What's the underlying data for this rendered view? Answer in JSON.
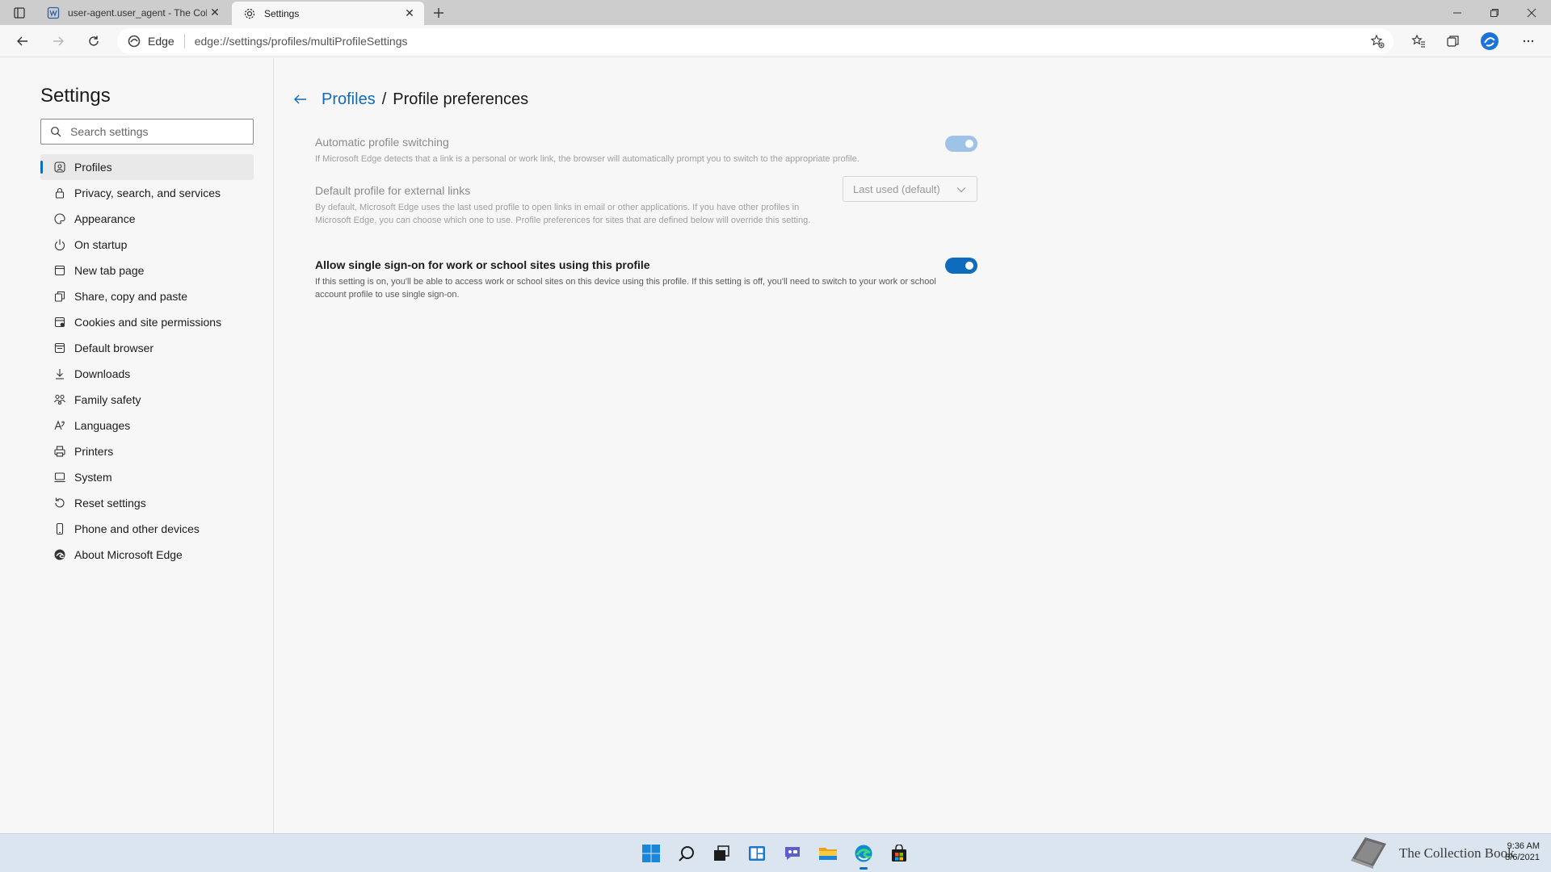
{
  "browser": {
    "tabs": [
      {
        "title": "user-agent.user_agent - The Coll",
        "favicon": "document-icon",
        "active": false
      },
      {
        "title": "Settings",
        "favicon": "gear-icon",
        "active": true
      }
    ],
    "address": {
      "site_label": "Edge",
      "url": "edge://settings/profiles/multiProfileSettings"
    }
  },
  "sidebar": {
    "title": "Settings",
    "search_placeholder": "Search settings",
    "items": [
      {
        "label": "Profiles",
        "icon": "profile-icon",
        "selected": true
      },
      {
        "label": "Privacy, search, and services",
        "icon": "lock-icon"
      },
      {
        "label": "Appearance",
        "icon": "palette-icon"
      },
      {
        "label": "On startup",
        "icon": "power-icon"
      },
      {
        "label": "New tab page",
        "icon": "new-tab-icon"
      },
      {
        "label": "Share, copy and paste",
        "icon": "share-icon"
      },
      {
        "label": "Cookies and site permissions",
        "icon": "cookies-icon"
      },
      {
        "label": "Default browser",
        "icon": "browser-icon"
      },
      {
        "label": "Downloads",
        "icon": "download-icon"
      },
      {
        "label": "Family safety",
        "icon": "family-icon"
      },
      {
        "label": "Languages",
        "icon": "language-icon"
      },
      {
        "label": "Printers",
        "icon": "printer-icon"
      },
      {
        "label": "System",
        "icon": "system-icon"
      },
      {
        "label": "Reset settings",
        "icon": "reset-icon"
      },
      {
        "label": "Phone and other devices",
        "icon": "phone-icon"
      },
      {
        "label": "About Microsoft Edge",
        "icon": "edge-icon"
      }
    ]
  },
  "main": {
    "breadcrumb": {
      "parent": "Profiles",
      "separator": "/",
      "current": "Profile preferences"
    },
    "settings": [
      {
        "title": "Automatic profile switching",
        "description": "If Microsoft Edge detects that a link is a personal or work link, the browser will automatically prompt you to switch to the appropriate profile.",
        "control": "toggle",
        "state": "on",
        "enabled": false
      },
      {
        "title": "Default profile for external links",
        "description": "By default, Microsoft Edge uses the last used profile to open links in email or other applications. If you have other profiles in Microsoft Edge, you can choose which one to use. Profile preferences for sites that are defined below will override this setting.",
        "control": "dropdown",
        "value": "Last used (default)",
        "enabled": false
      },
      {
        "title": "Allow single sign-on for work or school sites using this profile",
        "description": "If this setting is on, you'll be able to access work or school sites on this device using this profile. If this setting is off, you'll need to switch to your work or school account profile to use single sign-on.",
        "control": "toggle",
        "state": "on",
        "enabled": true
      }
    ]
  },
  "taskbar": {
    "icons": [
      "start-icon",
      "search-icon",
      "task-view-icon",
      "widgets-icon",
      "chat-icon",
      "file-explorer-icon",
      "edge-icon",
      "store-icon"
    ],
    "active": "edge-icon",
    "clock": {
      "time": "9:36 AM",
      "date": "8/6/2021"
    },
    "watermark": "The Collection Book"
  },
  "colors": {
    "accent": "#0f6cbd",
    "accent_disabled": "#9fc3e6",
    "taskbar": "#dbe5ef"
  }
}
